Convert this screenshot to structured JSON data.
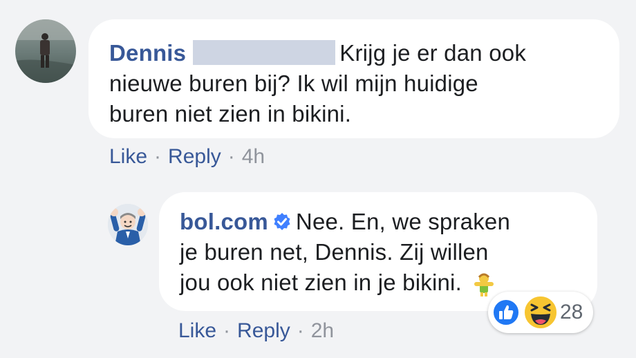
{
  "comments": [
    {
      "author": "Dennis",
      "author_redacted": true,
      "text_lines": [
        "Krijg je er dan ook",
        "nieuwe buren bij? Ik wil mijn huidige",
        "buren niet zien in bikini."
      ],
      "actions": {
        "like": "Like",
        "reply": "Reply",
        "sep": "·",
        "time": "4h"
      },
      "avatar_icon": "user-photo-avatar"
    },
    {
      "author": "bol.com",
      "verified_icon": "verified-badge-icon",
      "text_lines": [
        "Nee. En, we spraken",
        "je buren net, Dennis. Zij willen",
        "jou ook niet zien in je bikini."
      ],
      "emoji_icon": "bikini-emoji-icon",
      "actions": {
        "like": "Like",
        "reply": "Reply",
        "sep": "·",
        "time": "2h"
      },
      "avatar_icon": "bol-com-avatar",
      "reactions": {
        "icons": [
          "like-reaction-icon",
          "haha-reaction-icon"
        ],
        "count": "28"
      }
    }
  ],
  "colors": {
    "background": "#f2f3f5",
    "bubble": "#ffffff",
    "link": "#385898",
    "muted": "#90949c",
    "verified": "#4080ff",
    "like_blue": "#2078f4",
    "haha_yellow": "#f7c531"
  }
}
